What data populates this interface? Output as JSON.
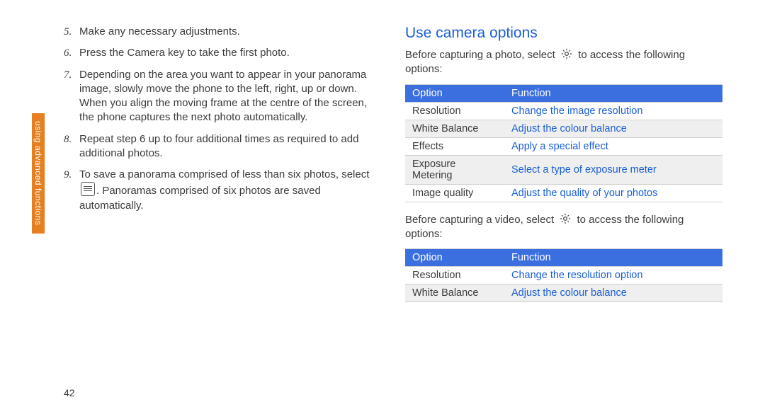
{
  "sidebar": {
    "label": "using advanced functions"
  },
  "page_number": "42",
  "left": {
    "steps": [
      {
        "n": "5.",
        "text": "Make any necessary adjustments."
      },
      {
        "n": "6.",
        "text": "Press the Camera key to take the first photo."
      },
      {
        "n": "7.",
        "text": "Depending on the area you want to appear in your panorama image, slowly move the phone to the left, right, up or down. When you align the moving frame at the centre of the screen, the phone captures the next photo automatically."
      },
      {
        "n": "8.",
        "text": "Repeat step 6 up to four additional times as required to add additional photos."
      },
      {
        "n": "9.",
        "pre": "To save a panorama comprised of less than six photos, select ",
        "post": ". Panoramas comprised of six photos are saved automatically."
      }
    ]
  },
  "right": {
    "heading": "Use camera options",
    "intro1_pre": "Before capturing a photo, select ",
    "intro1_post": " to access the following options:",
    "intro2_pre": "Before capturing a video, select ",
    "intro2_post": " to access the following options:",
    "th_option": "Option",
    "th_function": "Function",
    "table1": [
      {
        "option": "Resolution",
        "func": "Change the image resolution"
      },
      {
        "option": "White Balance",
        "func": "Adjust the colour balance"
      },
      {
        "option": "Effects",
        "func": "Apply a special effect"
      },
      {
        "option": "Exposure Metering",
        "func": "Select a type of exposure meter"
      },
      {
        "option": "Image quality",
        "func": "Adjust the quality of your photos"
      }
    ],
    "table2": [
      {
        "option": "Resolution",
        "func": "Change the resolution option"
      },
      {
        "option": "White Balance",
        "func": "Adjust the colour balance"
      }
    ]
  }
}
